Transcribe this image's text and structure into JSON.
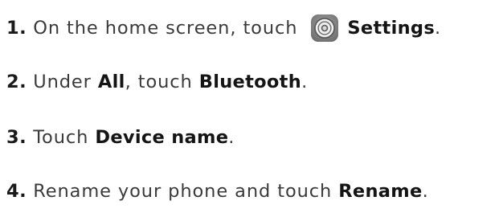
{
  "steps": [
    {
      "number": "1.",
      "before": "On the home screen, touch",
      "icon": "settings-gear-icon",
      "target": "Settings",
      "after": "."
    },
    {
      "number": "2.",
      "before": "Under ",
      "category": "All",
      "middle": ", touch ",
      "target": "Bluetooth",
      "after": "."
    },
    {
      "number": "3.",
      "before": "Touch ",
      "target": "Device name",
      "after": "."
    },
    {
      "number": "4.",
      "before": "Rename your phone and touch ",
      "target": "Rename",
      "after": "."
    }
  ],
  "colors": {
    "text": "#3a3a3a",
    "emphasis": "#141414",
    "icon_ring": "#6d6d6d",
    "icon_tile": "#8a8a8a"
  }
}
